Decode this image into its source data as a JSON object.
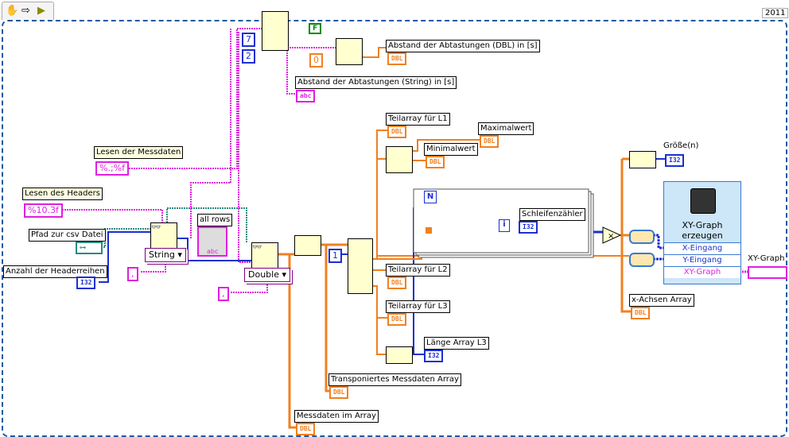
{
  "toolbar": {
    "icons": [
      "hand-icon",
      "arrow-icon",
      "run-icon"
    ],
    "version": "2011"
  },
  "constants": {
    "read_data_format": "%.;%f",
    "read_header_format": "%10.3f",
    "row_index": "7",
    "col_index": "2",
    "bool_false": "F",
    "zero": "0",
    "delimiter1": ",",
    "delimiter2": ",",
    "index_one": "1"
  },
  "labels": {
    "read_data": "Lesen der Messdaten",
    "read_header": "Lesen des Headers",
    "csv_path": "Pfad zur csv Datei",
    "header_rows": "Anzahl der Headerreihen",
    "all_rows": "all rows",
    "interval_dbl": "Abstand der Abtastungen (DBL) in [s]",
    "interval_str": "Abstand der Abtastungen (String) in [s]",
    "sub_l1": "Teilarray für L1",
    "max": "Maximalwert",
    "min": "Minimalwert",
    "sub_l2": "Teilarray für L2",
    "sub_l3": "Teilarray für L3",
    "len_l3": "Länge Array L3",
    "transposed": "Transponiertes Messdaten Array",
    "data_array": "Messdaten im Array",
    "loop_counter": "Schleifenzähler",
    "size": "Größe(n)",
    "xy_graph": "XY-Graph",
    "x_axis": "x-Achsen Array",
    "loop_n": "N",
    "loop_i": "i"
  },
  "rings": {
    "type1": "String",
    "type2": "Double"
  },
  "terminals": {
    "dbl": "DBL",
    "i32": "I32",
    "abc": "abc"
  },
  "express_vi": {
    "title": "XY-Graph erzeugen",
    "inputs": [
      "X-Eingang",
      "Y-Eingang"
    ],
    "output": "XY-Graph"
  },
  "colors": {
    "dbl": "#f08020",
    "i32": "#1a30d0",
    "string": "#e020e0",
    "path": "#2a8a80",
    "frame": "#1a5aa0"
  }
}
